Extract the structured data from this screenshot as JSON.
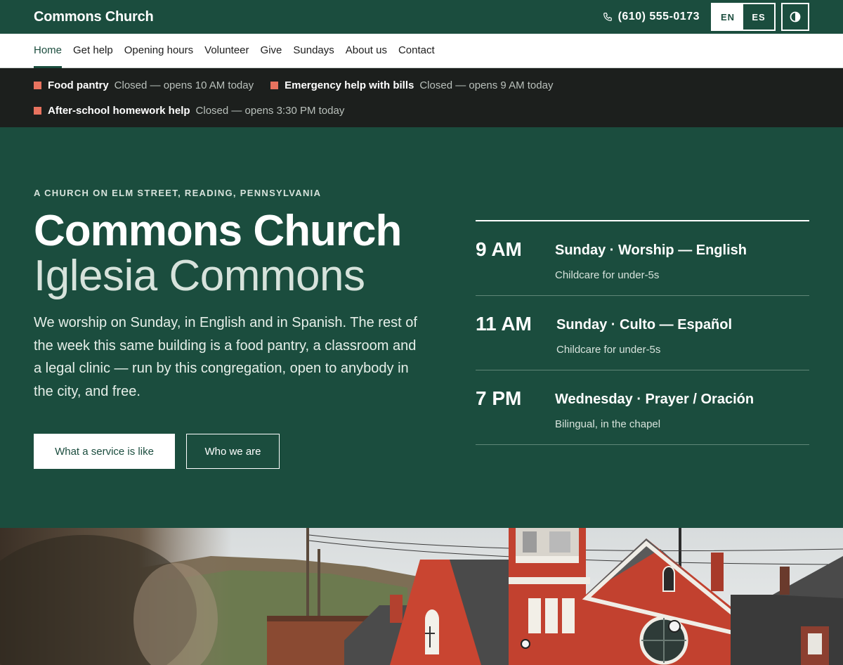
{
  "header": {
    "brand": "Commons Church",
    "phone": "(610) 555-0173",
    "lang_en": "EN",
    "lang_es": "ES"
  },
  "nav": {
    "items": [
      "Home",
      "Get help",
      "Opening hours",
      "Volunteer",
      "Give",
      "Sundays",
      "About us",
      "Contact"
    ]
  },
  "status": {
    "items": [
      {
        "name": "Food pantry",
        "state": "Closed — opens 10 AM today"
      },
      {
        "name": "Emergency help with bills",
        "state": "Closed — opens 9 AM today"
      },
      {
        "name": "After-school homework help",
        "state": "Closed — opens 3:30 PM today"
      }
    ],
    "closed_color": "#e8735f"
  },
  "hero": {
    "eyebrow": "A CHURCH ON ELM STREET, READING, PENNSYLVANIA",
    "title": "Commons Church",
    "subtitle": "Iglesia Commons",
    "lede": "We worship on Sunday, in English and in Spanish. The rest of the week this same building is a food pantry, a classroom and a legal clinic — run by this congregation, open to anybody in the city, and free.",
    "primary_button": "What a service is like",
    "secondary_button": "Who we are"
  },
  "schedule": [
    {
      "time": "9 AM",
      "title": "Sunday · Worship — English",
      "note": "Childcare for under-5s"
    },
    {
      "time": "11 AM",
      "title": "Sunday · Culto — Español",
      "note": "Childcare for under-5s"
    },
    {
      "time": "7 PM",
      "title": "Wednesday · Prayer / Oración",
      "note": "Bilingual, in the chapel"
    }
  ],
  "colors": {
    "brand_green": "#1b4d3e",
    "dark_strip": "#1c1f1d",
    "brick": "#c2412f"
  }
}
